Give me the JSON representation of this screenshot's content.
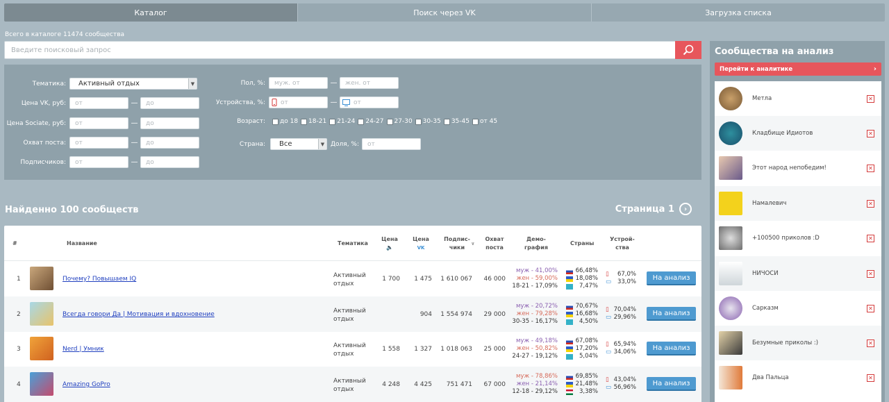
{
  "tabs": [
    {
      "label": "Каталог",
      "active": true
    },
    {
      "label": "Поиск через VK",
      "active": false
    },
    {
      "label": "Загрузка списка",
      "active": false
    }
  ],
  "catalog_count": "Всего в каталоге 11474 сообщества",
  "search": {
    "placeholder": "Введите поисковый запрос"
  },
  "filters": {
    "topic_label": "Тематика:",
    "topic_value": "Активный отдых",
    "price_vk_label": "Цена VK, руб:",
    "price_sociate_label": "Цена Sociate, руб:",
    "reach_label": "Охват поста:",
    "subscribers_label": "Подписчиков:",
    "from": "от",
    "to": "до",
    "dash": "—",
    "gender_label": "Пол, %:",
    "male_placeholder": "муж. от",
    "female_placeholder": "жен. от",
    "devices_label": "Устройства, %:",
    "age_label": "Возраст:",
    "age_options": [
      "до 18",
      "18-21",
      "21-24",
      "24-27",
      "27-30",
      "30-35",
      "35-45",
      "от 45"
    ],
    "country_label": "Страна:",
    "country_value": "Все",
    "share_label": "Доля, %:"
  },
  "results": {
    "found": "Найденно 100 сообществ",
    "page": "Страница 1"
  },
  "table": {
    "headers": {
      "num": "#",
      "name": "Название",
      "topic": "Тематика",
      "price": "Цена",
      "price_vk": "Цена",
      "subs_1": "Подпис-",
      "subs_2": "чики",
      "reach_1": "Охват",
      "reach_2": "поста",
      "demo_1": "Демо-",
      "demo_2": "графия",
      "countries": "Страны",
      "devices_1": "Устрой-",
      "devices_2": "ства"
    },
    "add_label": "На анализ",
    "rows": [
      {
        "n": "1",
        "name": "Почему? Повышаем IQ",
        "topic_1": "Активный",
        "topic_2": "отдых",
        "price": "1 700",
        "price_vk": "1 475",
        "subs": "1 610 067",
        "reach": "46 000",
        "male": "муж - 41,00%",
        "female": "жен - 59,00%",
        "age": "18-21 - 17,09%",
        "c1": "66,48%",
        "c2": "18,08%",
        "c3": "7,47%",
        "mobile": "67,0%",
        "desktop": "33,0%"
      },
      {
        "n": "2",
        "name": "Всегда говори Да | Мотивация и вдохновение",
        "topic_1": "Активный",
        "topic_2": "отдых",
        "price": "",
        "price_vk": "904",
        "subs": "1 554 974",
        "reach": "29 000",
        "male": "муж - 20,72%",
        "female": "жен - 79,28%",
        "age": "30-35 - 16,17%",
        "c1": "70,67%",
        "c2": "16,68%",
        "c3": "4,50%",
        "mobile": "70,04%",
        "desktop": "29,96%"
      },
      {
        "n": "3",
        "name": "Nerd | Умник",
        "topic_1": "Активный",
        "topic_2": "отдых",
        "price": "1 558",
        "price_vk": "1 327",
        "subs": "1 018 063",
        "reach": "25 000",
        "male": "муж - 49,18%",
        "female": "жен - 50,82%",
        "age": "24-27 - 19,12%",
        "c1": "67,08%",
        "c2": "17,20%",
        "c3": "5,04%",
        "mobile": "65,94%",
        "desktop": "34,06%"
      },
      {
        "n": "4",
        "name": "Amazing GoPro",
        "topic_1": "Активный",
        "topic_2": "отдых",
        "price": "4 248",
        "price_vk": "4 425",
        "subs": "751 471",
        "reach": "67 000",
        "male": "муж - 78,86%",
        "female": "жен - 21,14%",
        "age": "12-18 - 29,12%",
        "c1": "69,85%",
        "c2": "21,48%",
        "c3": "3,38%",
        "mobile": "43,04%",
        "desktop": "56,96%"
      }
    ]
  },
  "analysis": {
    "title": "Сообщества на анализ",
    "goto": "Перейти к аналитике",
    "items": [
      "Метла",
      "Кладбище Идиотов",
      "Этот народ непобедим!",
      "Намалевич",
      "+100500 приколов :D",
      "НИЧОСИ",
      "Сарказм",
      "Безумные приколы :)",
      "Два Пальца"
    ]
  },
  "colors": {
    "accent_red": "#e7565c",
    "button_blue": "#4e9ad0",
    "panel": "#8fa1aa",
    "link": "#1f3fbf"
  }
}
